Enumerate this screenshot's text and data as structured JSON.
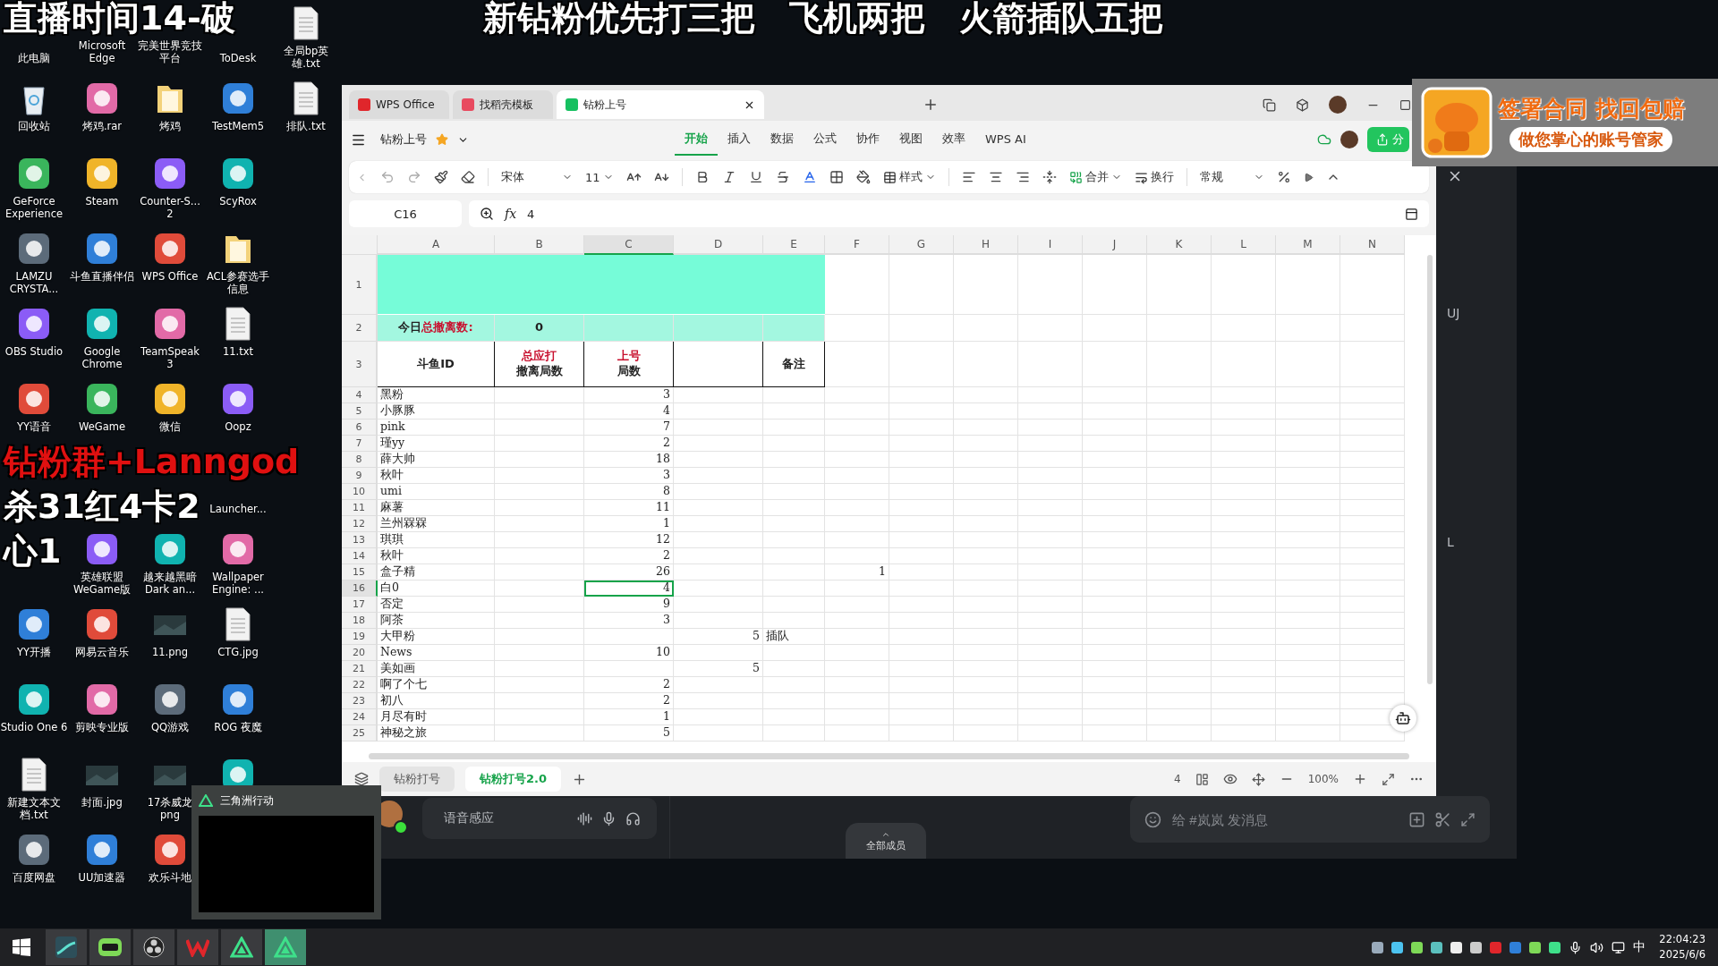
{
  "captions": {
    "top_left": "直播时间14-破",
    "top_center": "新钻粉优先打三把　飞机两把　火箭插队五把",
    "group": "钻粉群+Lanngod",
    "stats_1": "杀31红4卡2",
    "stats_2": "心1"
  },
  "desktop_rows": [
    [
      {
        "label": "此电脑",
        "kind": "covered"
      },
      {
        "label": "Microsoft Edge",
        "kind": "covered"
      },
      {
        "label": "完美世界竞技平台",
        "kind": "covered"
      },
      {
        "label": "ToDesk",
        "kind": "covered"
      },
      {
        "label": "全局bp英雄.txt",
        "kind": "file"
      }
    ],
    [
      {
        "label": "回收站",
        "kind": "bin"
      },
      {
        "label": "烤鸡.rar",
        "kind": "app"
      },
      {
        "label": "烤鸡",
        "kind": "folder"
      },
      {
        "label": "TestMem5",
        "kind": "app"
      },
      {
        "label": "排队.txt",
        "kind": "file"
      }
    ],
    [
      {
        "label": "GeForce Experience",
        "kind": "app"
      },
      {
        "label": "Steam",
        "kind": "app"
      },
      {
        "label": "Counter-S... 2",
        "kind": "app"
      },
      {
        "label": "ScyRox",
        "kind": "app"
      }
    ],
    [
      {
        "label": "LAMZU CRYSTA...",
        "kind": "app"
      },
      {
        "label": "斗鱼直播伴侣",
        "kind": "app"
      },
      {
        "label": "WPS Office",
        "kind": "app"
      },
      {
        "label": "ACL参赛选手信息",
        "kind": "folder"
      }
    ],
    [
      {
        "label": "OBS Studio",
        "kind": "app"
      },
      {
        "label": "Google Chrome",
        "kind": "app"
      },
      {
        "label": "TeamSpeak 3",
        "kind": "app"
      },
      {
        "label": "11.txt",
        "kind": "file"
      }
    ],
    [
      {
        "label": "YY语音",
        "kind": "app"
      },
      {
        "label": "WeGame",
        "kind": "app"
      },
      {
        "label": "微信",
        "kind": "app"
      },
      {
        "label": "Oopz",
        "kind": "app"
      }
    ],
    [
      {
        "kind": "blank"
      },
      {
        "kind": "blank"
      },
      {
        "kind": "blank"
      },
      {
        "label": "Launcher...",
        "kind": "covered"
      }
    ],
    [
      {
        "kind": "blank"
      },
      {
        "label": "英雄联盟 WeGame版",
        "kind": "app"
      },
      {
        "label": "越来越黑暗 Dark an...",
        "kind": "app"
      },
      {
        "label": "Wallpaper Engine: ...",
        "kind": "app"
      }
    ],
    [
      {
        "label": "YY开播",
        "kind": "app"
      },
      {
        "label": "网易云音乐",
        "kind": "app"
      },
      {
        "label": "11.png",
        "kind": "image"
      },
      {
        "label": "CTG.jpg",
        "kind": "file"
      }
    ],
    [
      {
        "label": "Studio One 6",
        "kind": "app"
      },
      {
        "label": "剪映专业版",
        "kind": "app"
      },
      {
        "label": "QQ游戏",
        "kind": "app"
      },
      {
        "label": "ROG 夜魔",
        "kind": "app"
      }
    ],
    [
      {
        "label": "新建文本文档.txt",
        "kind": "file"
      },
      {
        "label": "封面.jpg",
        "kind": "image"
      },
      {
        "label": "17杀威龙 png",
        "kind": "image"
      },
      {
        "kind": "app"
      }
    ],
    [
      {
        "label": "百度网盘",
        "kind": "app"
      },
      {
        "label": "UU加速器",
        "kind": "app"
      },
      {
        "label": "欢乐斗地",
        "kind": "app"
      }
    ]
  ],
  "preview": {
    "title": "三角洲行动"
  },
  "ad": {
    "line_1": "签署合同 找回包赔",
    "line_2": "做您掌心的账号管家"
  },
  "side_letters": [
    "UJ",
    "L"
  ],
  "chat": {
    "voice": "语音感应",
    "members": "全部成员",
    "message_placeholder": "给 #岚岚 发消息"
  },
  "wps": {
    "tabs": [
      {
        "label": "WPS Office",
        "kind": "home",
        "selected": false
      },
      {
        "label": "找稻壳模板",
        "kind": "template",
        "selected": false
      },
      {
        "label": "钻粉上号",
        "kind": "sheet",
        "selected": true
      }
    ],
    "doc_title": "钻粉上号",
    "menu": [
      {
        "label": "开始",
        "selected": true
      },
      {
        "label": "插入",
        "selected": false
      },
      {
        "label": "数据",
        "selected": false
      },
      {
        "label": "公式",
        "selected": false
      },
      {
        "label": "协作",
        "selected": false
      },
      {
        "label": "视图",
        "selected": false
      },
      {
        "label": "效率",
        "selected": false
      },
      {
        "label": "WPS AI",
        "selected": false
      }
    ],
    "share": "分",
    "toolbar": {
      "font": "宋体",
      "size": "11",
      "style": "样式",
      "merge": "合并",
      "wrap": "换行",
      "format": "常规"
    },
    "cell_ref": "C16",
    "fx": "fx",
    "formula": "4",
    "columns": [
      {
        "label": "A",
        "selected": false
      },
      {
        "label": "B",
        "selected": false
      },
      {
        "label": "C",
        "selected": true
      },
      {
        "label": "D",
        "selected": false
      },
      {
        "label": "E",
        "selected": false
      },
      {
        "label": "F",
        "selected": false
      },
      {
        "label": "G",
        "selected": false
      },
      {
        "label": "H",
        "selected": false
      },
      {
        "label": "I",
        "selected": false
      },
      {
        "label": "J",
        "selected": false
      },
      {
        "label": "K",
        "selected": false
      },
      {
        "label": "L",
        "selected": false
      },
      {
        "label": "M",
        "selected": false
      },
      {
        "label": "N",
        "selected": false
      }
    ],
    "rows": [
      {
        "num": "1",
        "kind": "banner",
        "selected": false
      },
      {
        "num": "2",
        "kind": "summary",
        "selected": false,
        "cells": {
          "A": "今日**总撤离数:**",
          "B": "0"
        }
      },
      {
        "num": "3",
        "kind": "header",
        "selected": false,
        "cells": {
          "A": "斗鱼ID",
          "B": "**总应打**撤离局数",
          "C": "**上号**局数",
          "E": "备注"
        }
      },
      {
        "num": "4",
        "kind": "data",
        "selected": false,
        "cells": {
          "A": "黑粉",
          "C": "3"
        }
      },
      {
        "num": "5",
        "kind": "data",
        "selected": false,
        "cells": {
          "A": "小豚豚",
          "C": "4"
        }
      },
      {
        "num": "6",
        "kind": "data",
        "selected": false,
        "cells": {
          "A": "pink",
          "C": "7"
        }
      },
      {
        "num": "7",
        "kind": "data",
        "selected": false,
        "cells": {
          "A": "瑾yy",
          "C": "2"
        }
      },
      {
        "num": "8",
        "kind": "data",
        "selected": false,
        "cells": {
          "A": "薛大帅",
          "C": "18"
        }
      },
      {
        "num": "9",
        "kind": "data",
        "selected": false,
        "cells": {
          "A": "秋叶",
          "C": "3"
        }
      },
      {
        "num": "10",
        "kind": "data",
        "selected": false,
        "cells": {
          "A": "umi",
          "C": "8"
        }
      },
      {
        "num": "11",
        "kind": "data",
        "selected": false,
        "cells": {
          "A": "麻薯",
          "C": "11"
        }
      },
      {
        "num": "12",
        "kind": "data",
        "selected": false,
        "cells": {
          "A": "兰州槑槑",
          "C": "1"
        }
      },
      {
        "num": "13",
        "kind": "data",
        "selected": false,
        "cells": {
          "A": "琪琪",
          "C": "12"
        }
      },
      {
        "num": "14",
        "kind": "data",
        "selected": false,
        "cells": {
          "A": "秋叶",
          "C": "2"
        }
      },
      {
        "num": "15",
        "kind": "data",
        "selected": false,
        "cells": {
          "A": "盒子精",
          "C": "26",
          "F": "1"
        }
      },
      {
        "num": "16",
        "kind": "data",
        "selected": true,
        "cells": {
          "A": "白0",
          "C": "4"
        }
      },
      {
        "num": "17",
        "kind": "data",
        "selected": false,
        "cells": {
          "A": "否定",
          "C": "9"
        }
      },
      {
        "num": "18",
        "kind": "data",
        "selected": false,
        "cells": {
          "A": "阿茶",
          "C": "3"
        }
      },
      {
        "num": "19",
        "kind": "data",
        "selected": false,
        "cells": {
          "A": "大甲粉",
          "D": "5",
          "E": "插队"
        }
      },
      {
        "num": "20",
        "kind": "data",
        "selected": false,
        "cells": {
          "A": "News",
          "C": "10"
        }
      },
      {
        "num": "21",
        "kind": "data",
        "selected": false,
        "cells": {
          "A": "美如画",
          "D": "5"
        }
      },
      {
        "num": "22",
        "kind": "data",
        "selected": false,
        "cells": {
          "A": "啊了个七",
          "C": "2"
        }
      },
      {
        "num": "23",
        "kind": "data",
        "selected": false,
        "cells": {
          "A": "初八",
          "C": "2"
        }
      },
      {
        "num": "24",
        "kind": "data",
        "selected": false,
        "cells": {
          "A": "月尽有时",
          "C": "1"
        }
      },
      {
        "num": "25",
        "kind": "data",
        "selected": false,
        "cells": {
          "A": "神秘之旅",
          "C": "5"
        }
      }
    ],
    "sheets": [
      {
        "label": "钻粉打号",
        "selected": false
      },
      {
        "label": "钻粉打号2.0",
        "selected": true
      }
    ],
    "status": {
      "count": "4",
      "zoom": "100%"
    }
  },
  "taskbar": {
    "apps": [
      {
        "kind": "studio",
        "active": false
      },
      {
        "kind": "chat",
        "active": false
      },
      {
        "kind": "obs",
        "active": false
      },
      {
        "kind": "wps",
        "active": false
      },
      {
        "kind": "game",
        "active": false
      },
      {
        "kind": "game",
        "active": true
      }
    ],
    "ime": "中",
    "time": "22:04:23",
    "date": "2025/6/6"
  }
}
